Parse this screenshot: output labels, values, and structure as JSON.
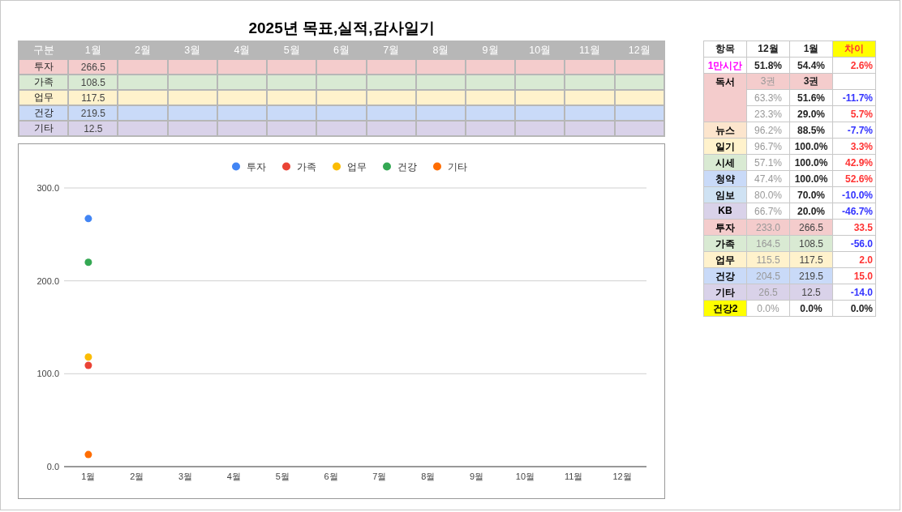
{
  "title": "2025년 목표,실적,감사일기",
  "monthly_table": {
    "columns": [
      "구분",
      "1월",
      "2월",
      "3월",
      "4월",
      "5월",
      "6월",
      "7월",
      "8월",
      "9월",
      "10월",
      "11월",
      "12월"
    ],
    "rows": [
      {
        "label": "투자",
        "color": "#f4cccc",
        "values": [
          "266.5"
        ]
      },
      {
        "label": "가족",
        "color": "#d9ead3",
        "values": [
          "108.5"
        ]
      },
      {
        "label": "업무",
        "color": "#fff2cc",
        "values": [
          "117.5"
        ]
      },
      {
        "label": "건강",
        "color": "#c9daf8",
        "values": [
          "219.5"
        ]
      },
      {
        "label": "기타",
        "color": "#d9d2e9",
        "values": [
          "12.5"
        ]
      }
    ]
  },
  "chart": {
    "chart_data": {
      "type": "scatter",
      "legend": "top",
      "categories": [
        "1월",
        "2월",
        "3월",
        "4월",
        "5월",
        "6월",
        "7월",
        "8월",
        "9월",
        "10월",
        "11월",
        "12월"
      ],
      "ylim": [
        0,
        300
      ],
      "yticks": [
        {
          "value": 0,
          "label": "0.0"
        },
        {
          "value": 100,
          "label": "100.0"
        },
        {
          "value": 200,
          "label": "200.0"
        },
        {
          "value": 300,
          "label": "300.0"
        }
      ],
      "series": [
        {
          "name": "투자",
          "color": "#4285f4",
          "values": [
            267,
            null,
            null,
            null,
            null,
            null,
            null,
            null,
            null,
            null,
            null,
            null
          ]
        },
        {
          "name": "가족",
          "color": "#ea4335",
          "values": [
            109,
            null,
            null,
            null,
            null,
            null,
            null,
            null,
            null,
            null,
            null,
            null
          ]
        },
        {
          "name": "업무",
          "color": "#fbbc04",
          "values": [
            118,
            null,
            null,
            null,
            null,
            null,
            null,
            null,
            null,
            null,
            null,
            null
          ]
        },
        {
          "name": "건강",
          "color": "#34a853",
          "values": [
            220,
            null,
            null,
            null,
            null,
            null,
            null,
            null,
            null,
            null,
            null,
            null
          ]
        },
        {
          "name": "기타",
          "color": "#ff6d01",
          "values": [
            13,
            null,
            null,
            null,
            null,
            null,
            null,
            null,
            null,
            null,
            null,
            null
          ]
        }
      ]
    }
  },
  "summary_table": {
    "columns": [
      {
        "label": "항목",
        "highlight": false
      },
      {
        "label": "12월",
        "highlight": false
      },
      {
        "label": "1월",
        "highlight": false
      },
      {
        "label": "차이",
        "highlight": true
      }
    ],
    "rows": [
      {
        "label": "1만시간",
        "color": "#ffffff",
        "label_highlight": true,
        "lines": [
          {
            "kind": "headline",
            "prev": "51.8%",
            "cur": "54.4%",
            "diff": "2.6%",
            "color": "#ff3333"
          }
        ]
      },
      {
        "label": "독서",
        "color": "#f4cccc",
        "label_highlight": false,
        "lines": [
          {
            "kind": "count",
            "prev": "3권",
            "cur": "3권"
          },
          {
            "kind": "rate",
            "prev": "63.3%",
            "cur": "51.6%",
            "diff": "-11.7%",
            "color": "#3333ff"
          },
          {
            "kind": "rate",
            "prev": "23.3%",
            "cur": "29.0%",
            "diff": "5.7%",
            "color": "#ff3333"
          }
        ]
      },
      {
        "label": "뉴스",
        "color": "#fce5cd",
        "label_highlight": false,
        "lines": [
          {
            "kind": "rate",
            "prev": "96.2%",
            "cur": "88.5%",
            "diff": "-7.7%",
            "color": "#3333ff"
          }
        ]
      },
      {
        "label": "일기",
        "color": "#fff2cc",
        "label_highlight": false,
        "lines": [
          {
            "kind": "rate",
            "prev": "96.7%",
            "cur": "100.0%",
            "diff": "3.3%",
            "color": "#ff3333"
          }
        ]
      },
      {
        "label": "시세",
        "color": "#d9ead3",
        "label_highlight": false,
        "lines": [
          {
            "kind": "rate",
            "prev": "57.1%",
            "cur": "100.0%",
            "diff": "42.9%",
            "color": "#ff3333"
          }
        ]
      },
      {
        "label": "청약",
        "color": "#c9daf8",
        "label_highlight": false,
        "lines": [
          {
            "kind": "rate",
            "prev": "47.4%",
            "cur": "100.0%",
            "diff": "52.6%",
            "color": "#ff3333"
          }
        ]
      },
      {
        "label": "임보",
        "color": "#cfe2f3",
        "label_highlight": false,
        "lines": [
          {
            "kind": "rate",
            "prev": "80.0%",
            "cur": "70.0%",
            "diff": "-10.0%",
            "color": "#3333ff"
          }
        ]
      },
      {
        "label": "KB",
        "color": "#d9d2e9",
        "label_highlight": false,
        "lines": [
          {
            "kind": "rate",
            "prev": "66.7%",
            "cur": "20.0%",
            "diff": "-46.7%",
            "color": "#3333ff"
          }
        ]
      },
      {
        "label": "투자",
        "color": "#f4cccc",
        "label_highlight": false,
        "lines": [
          {
            "kind": "score",
            "prev": "233.0",
            "cur": "266.5",
            "diff": "33.5",
            "color": "#ff3333"
          }
        ]
      },
      {
        "label": "가족",
        "color": "#d9ead3",
        "label_highlight": false,
        "lines": [
          {
            "kind": "score",
            "prev": "164.5",
            "cur": "108.5",
            "diff": "-56.0",
            "color": "#3333ff"
          }
        ]
      },
      {
        "label": "업무",
        "color": "#fff2cc",
        "label_highlight": false,
        "lines": [
          {
            "kind": "score",
            "prev": "115.5",
            "cur": "117.5",
            "diff": "2.0",
            "color": "#ff3333"
          }
        ]
      },
      {
        "label": "건강",
        "color": "#c9daf8",
        "label_highlight": false,
        "lines": [
          {
            "kind": "score",
            "prev": "204.5",
            "cur": "219.5",
            "diff": "15.0",
            "color": "#ff3333"
          }
        ]
      },
      {
        "label": "기타",
        "color": "#d9d2e9",
        "label_highlight": false,
        "lines": [
          {
            "kind": "score",
            "prev": "26.5",
            "cur": "12.5",
            "diff": "-14.0",
            "color": "#3333ff"
          }
        ]
      },
      {
        "label": "건강2",
        "color": "#ffff00",
        "label_highlight": false,
        "lines": [
          {
            "kind": "rate",
            "prev": "0.0%",
            "cur": "0.0%",
            "diff": "0.0%",
            "color": "#222222"
          }
        ]
      }
    ]
  }
}
